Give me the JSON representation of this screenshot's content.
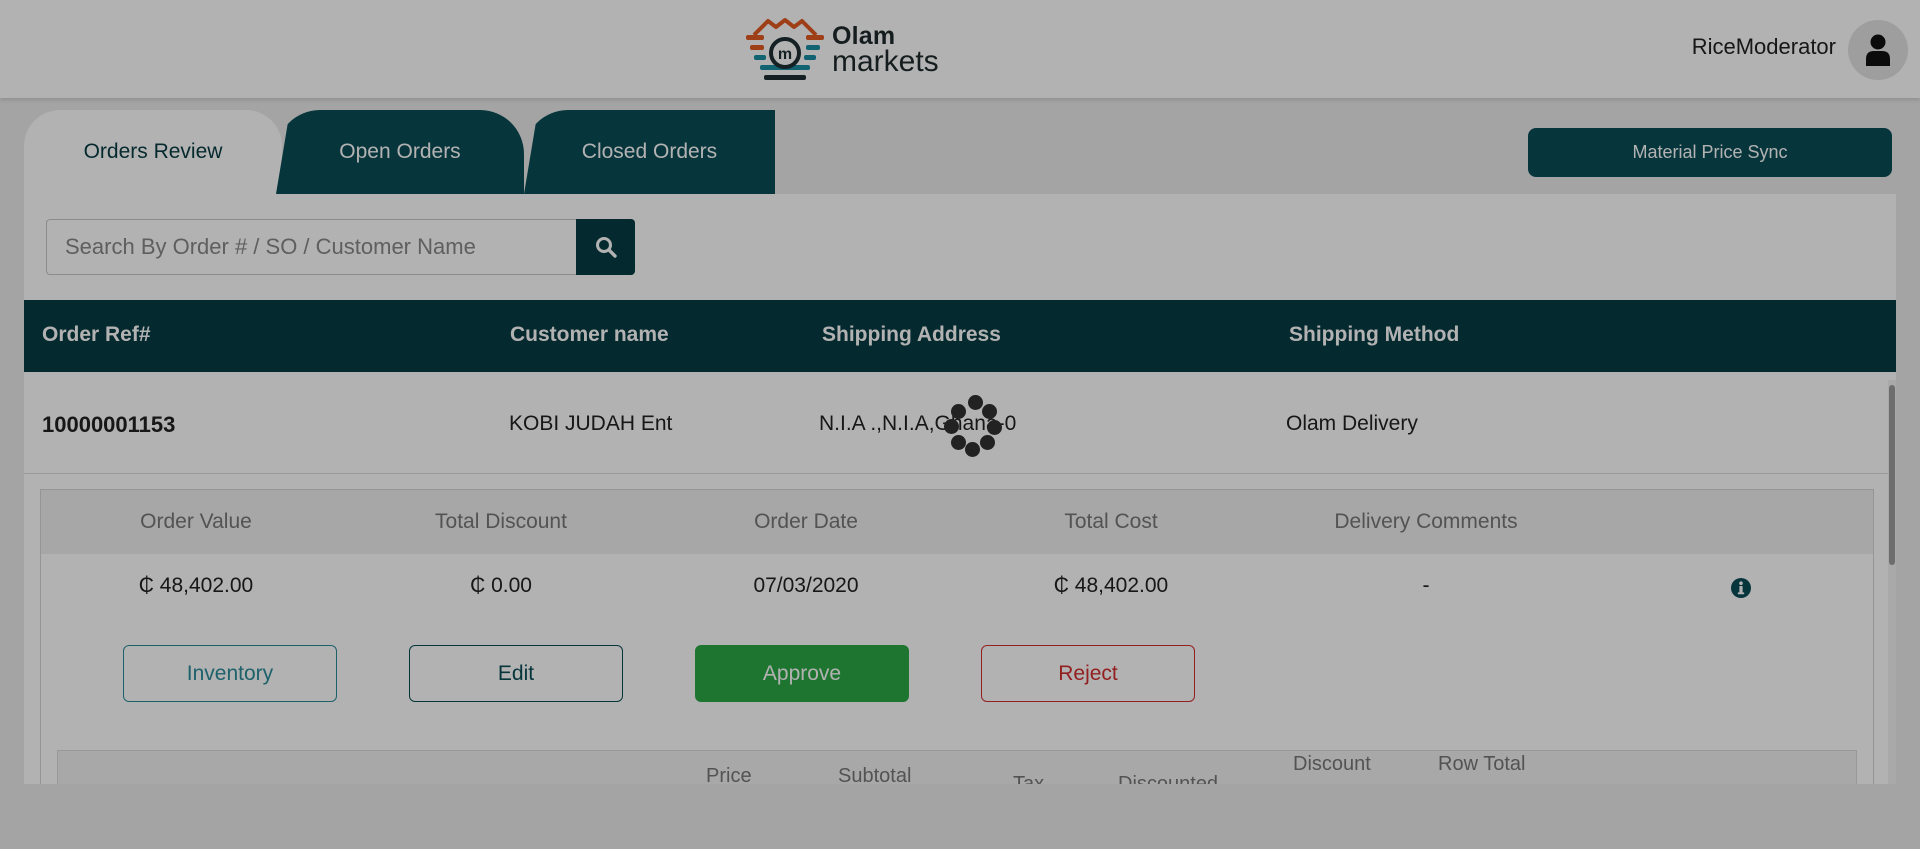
{
  "header": {
    "logo_word_1": "Olam",
    "logo_word_2": "markets",
    "user_name": "RiceModerator"
  },
  "tabs": [
    {
      "label": "Orders Review",
      "active": true
    },
    {
      "label": "Open Orders",
      "active": false
    },
    {
      "label": "Closed Orders",
      "active": false
    }
  ],
  "material_price_sync_label": "Material Price Sync",
  "search": {
    "placeholder": "Search By Order # / SO / Customer Name",
    "value": ""
  },
  "table": {
    "columns": [
      "Order Ref#",
      "Customer name",
      "Shipping Address",
      "Shipping Method"
    ],
    "rows": [
      {
        "order_ref": "10000001153",
        "customer_name": "KOBI JUDAH Ent",
        "shipping_address": "N.I.A .,N.I.A,Ghana-0",
        "shipping_method": "Olam Delivery"
      }
    ]
  },
  "order_details": {
    "columns": [
      "Order Value",
      "Total Discount",
      "Order Date",
      "Total Cost",
      "Delivery Comments"
    ],
    "values": [
      "₵ 48,402.00",
      "₵ 0.00",
      "07/03/2020",
      "₵ 48,402.00",
      "-"
    ],
    "actions": {
      "inventory": "Inventory",
      "edit": "Edit",
      "approve": "Approve",
      "reject": "Reject"
    },
    "items_columns_partial": [
      "Price",
      "Subtotal",
      "Tax",
      "Discounted",
      "Discount",
      "Row Total"
    ]
  },
  "colors": {
    "primary": "#0b4d57",
    "primary_dark": "#073b43",
    "approve": "#2ca845",
    "reject": "#d32f2f",
    "inventory": "#2a8c9a",
    "logo_orange": "#e35b22",
    "logo_teal": "#1b8fa3"
  },
  "loading": true
}
